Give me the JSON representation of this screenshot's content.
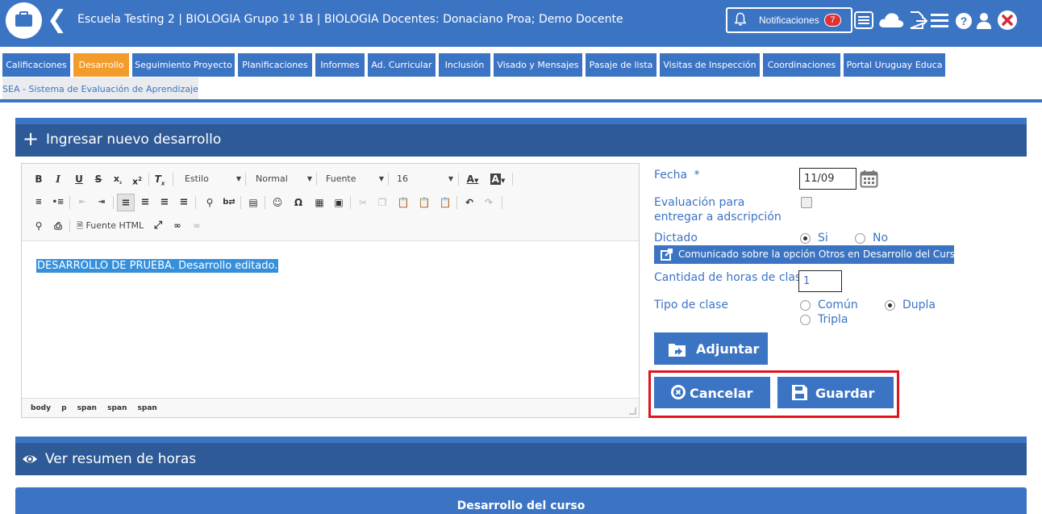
{
  "header": {
    "title": "Escuela Testing 2 | BIOLOGIA Grupo 1º 1B | BIOLOGIA Docentes: Donaciano Proa; Demo Docente",
    "notifications_label": "Notificaciones",
    "notifications_count": "7",
    "icons": [
      "briefcase-icon",
      "back-icon",
      "bell-icon",
      "list-card-icon",
      "cloud-icon",
      "export-icon",
      "menu-icon",
      "help-icon",
      "user-icon",
      "close-icon"
    ]
  },
  "tabs": [
    {
      "label": "Calificaciones",
      "active": false
    },
    {
      "label": "Desarrollo",
      "active": true
    },
    {
      "label": "Seguimiento Proyecto",
      "active": false
    },
    {
      "label": "Planificaciones",
      "active": false
    },
    {
      "label": "Informes",
      "active": false
    },
    {
      "label": "Ad. Curricular",
      "active": false
    },
    {
      "label": "Inclusión",
      "active": false
    },
    {
      "label": "Visado y Mensajes",
      "active": false
    },
    {
      "label": "Pasaje de lista",
      "active": false
    },
    {
      "label": "Visitas de Inspección",
      "active": false
    },
    {
      "label": "Coordinaciones",
      "active": false
    },
    {
      "label": "Portal Uruguay Educa",
      "active": false
    },
    {
      "label": "SEA - Sistema de Evaluación de Aprendizaje",
      "active": false
    }
  ],
  "panel": {
    "title": "Ingresar nuevo desarrollo"
  },
  "editor": {
    "style_select": "Estilo",
    "format_select": "Normal",
    "font_select": "Fuente",
    "size_select": "16",
    "source_label": "Fuente HTML",
    "content": "DESARROLLO DE PRUEBA.  Desarrollo editado.",
    "path": [
      "body",
      "p",
      "span",
      "span",
      "span"
    ]
  },
  "form": {
    "fecha_label": "Fecha",
    "required_mark": "*",
    "fecha_value": "11/09",
    "evaluacion_label": "Evaluación para entregar a adscripción",
    "evaluacion_checked": false,
    "dictado_label": "Dictado",
    "dictado_options": [
      "Si",
      "No"
    ],
    "dictado_selected": "Si",
    "comunicado_button": "Comunicado sobre la opción Otros en Desarrollo del Curso",
    "horas_label": "Cantidad de horas de clase:",
    "horas_value": "1",
    "tipo_label": "Tipo de clase",
    "tipo_options": [
      "Común",
      "Dupla",
      "Tripla"
    ],
    "tipo_selected": "Dupla",
    "adjuntar_button": "Adjuntar",
    "cancelar_button": "Cancelar",
    "guardar_button": "Guardar"
  },
  "summary": {
    "title": "Ver resumen de horas"
  },
  "desarrollo_del_curso": {
    "title": "Desarrollo del curso"
  },
  "colors": {
    "primary": "#3c74c4",
    "panel_dark": "#2f5a98",
    "active_tab": "#f39c2b",
    "badge": "#e03232",
    "highlight_box": "#e0141e",
    "selection": "#3490dc"
  }
}
